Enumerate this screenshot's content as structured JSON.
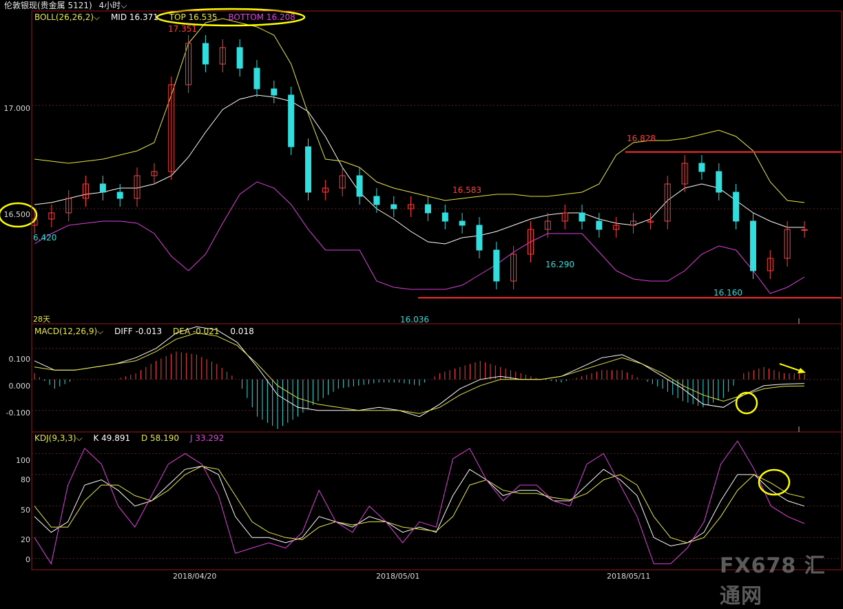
{
  "window": {
    "symbol": "伦敦银现(贵金属 5121)",
    "period": "4小时"
  },
  "colors": {
    "background": "#000000",
    "grid": "#6b1d1d",
    "up": "#ff4040",
    "down": "#33dddd",
    "mid": "#ffffff",
    "top": "#e8e846",
    "bottom": "#e040e0",
    "highlight": "#ffff00",
    "hline": "#ff3030"
  },
  "boll_panel": {
    "indicator": "BOLL(26,26,2)",
    "mid": "MID 16.371",
    "top": "TOP 16.535",
    "bottom": "BOTTOM 16.208",
    "yticks": [
      "17.000",
      "16.500"
    ],
    "days_label": "28天",
    "annotations": [
      {
        "text": "17.351",
        "color": "up"
      },
      {
        "text": "6.420",
        "color": "down"
      },
      {
        "text": "16.583",
        "color": "up"
      },
      {
        "text": "16.828",
        "color": "up"
      },
      {
        "text": "16.290",
        "color": "down"
      },
      {
        "text": "16.036",
        "color": "down"
      },
      {
        "text": "16.160",
        "color": "down"
      }
    ]
  },
  "macd_panel": {
    "indicator": "MACD(12,26,9)",
    "diff": "DIFF -0.013",
    "dea": "DEA -0.021",
    "macd": "0.018",
    "yticks": [
      "0.100",
      "0.000",
      "-0.100"
    ]
  },
  "kdj_panel": {
    "indicator": "KDJ(9,3,3)",
    "k": "K 49.891",
    "d": "D 58.190",
    "j": "J 33.292",
    "yticks": [
      "100",
      "80",
      "50",
      "20",
      "0"
    ]
  },
  "x_axis": {
    "dates": [
      "2018/04/20",
      "2018/05/01",
      "2018/05/11"
    ]
  },
  "watermark": "FX678 汇通网",
  "chart_data": [
    {
      "type": "line",
      "panel": "price",
      "indicator": "BOLL(26,26,2)",
      "ylim": [
        15.95,
        17.45
      ],
      "yticks": [
        17.0,
        16.5
      ],
      "x_dates": [
        "2018/04/20",
        "2018/05/01",
        "2018/05/11"
      ],
      "series": [
        {
          "name": "MID",
          "values": [
            16.52,
            16.53,
            16.55,
            16.57,
            16.58,
            16.6,
            16.6,
            16.62,
            16.66,
            16.75,
            16.87,
            16.98,
            17.03,
            17.05,
            17.04,
            17.02,
            16.97,
            16.85,
            16.7,
            16.58,
            16.5,
            16.45,
            16.39,
            16.34,
            16.33,
            16.36,
            16.37,
            16.39,
            16.42,
            16.45,
            16.47,
            16.48,
            16.48,
            16.45,
            16.43,
            16.42,
            16.45,
            16.54,
            16.6,
            16.62,
            16.6,
            16.54,
            16.48,
            16.44,
            16.41,
            16.41
          ]
        },
        {
          "name": "TOP",
          "values": [
            16.74,
            16.73,
            16.72,
            16.73,
            16.74,
            16.76,
            16.78,
            16.82,
            17.05,
            17.3,
            17.4,
            17.42,
            17.4,
            17.38,
            17.34,
            17.2,
            16.96,
            16.74,
            16.73,
            16.7,
            16.63,
            16.6,
            16.58,
            16.56,
            16.54,
            16.55,
            16.56,
            16.57,
            16.57,
            16.56,
            16.56,
            16.57,
            16.58,
            16.62,
            16.76,
            16.82,
            16.83,
            16.83,
            16.84,
            16.86,
            16.88,
            16.85,
            16.78,
            16.63,
            16.54,
            16.53
          ]
        },
        {
          "name": "BOTTOM",
          "values": [
            16.33,
            16.38,
            16.42,
            16.43,
            16.44,
            16.44,
            16.43,
            16.38,
            16.27,
            16.2,
            16.28,
            16.43,
            16.57,
            16.63,
            16.6,
            16.52,
            16.4,
            16.3,
            16.3,
            16.3,
            16.15,
            16.12,
            16.11,
            16.11,
            16.11,
            16.13,
            16.18,
            16.23,
            16.29,
            16.34,
            16.38,
            16.38,
            16.38,
            16.29,
            16.2,
            16.16,
            16.15,
            16.15,
            16.2,
            16.28,
            16.32,
            16.3,
            16.2,
            16.09,
            16.12,
            16.17
          ]
        }
      ],
      "candles_close": [
        16.45,
        16.48,
        16.55,
        16.62,
        16.58,
        16.55,
        16.66,
        16.68,
        17.1,
        17.3,
        17.2,
        17.28,
        17.18,
        17.08,
        17.05,
        16.8,
        16.58,
        16.6,
        16.66,
        16.56,
        16.52,
        16.5,
        16.52,
        16.48,
        16.44,
        16.42,
        16.3,
        16.15,
        16.28,
        16.4,
        16.44,
        16.48,
        16.44,
        16.4,
        16.42,
        16.44,
        16.44,
        16.62,
        16.72,
        16.68,
        16.58,
        16.44,
        16.2,
        16.26,
        16.4,
        16.4
      ],
      "price_labels": [
        17.351,
        16.42,
        16.583,
        16.828,
        16.29,
        16.036,
        16.16
      ]
    },
    {
      "type": "line",
      "panel": "MACD(12,26,9)",
      "ylim": [
        -0.165,
        0.175
      ],
      "yticks": [
        0.1,
        0.0,
        -0.1
      ],
      "series": [
        {
          "name": "DIFF",
          "values": [
            0.06,
            0.03,
            0.03,
            0.04,
            0.05,
            0.07,
            0.1,
            0.15,
            0.17,
            0.16,
            0.12,
            0.04,
            -0.05,
            -0.09,
            -0.1,
            -0.1,
            -0.1,
            -0.09,
            -0.1,
            -0.12,
            -0.08,
            -0.03,
            0.0,
            0.01,
            0.0,
            0.0,
            0.01,
            0.04,
            0.07,
            0.08,
            0.05,
            0.01,
            -0.03,
            -0.08,
            -0.09,
            -0.05,
            -0.02,
            -0.015,
            -0.013
          ]
        },
        {
          "name": "DEA",
          "values": [
            0.04,
            0.03,
            0.03,
            0.04,
            0.05,
            0.06,
            0.09,
            0.13,
            0.15,
            0.14,
            0.11,
            0.05,
            -0.02,
            -0.06,
            -0.08,
            -0.09,
            -0.1,
            -0.1,
            -0.1,
            -0.11,
            -0.09,
            -0.05,
            -0.02,
            0.0,
            0.0,
            0.0,
            0.01,
            0.03,
            0.05,
            0.07,
            0.05,
            0.02,
            -0.02,
            -0.05,
            -0.07,
            -0.05,
            -0.03,
            -0.022,
            -0.021
          ]
        }
      ],
      "histogram": [
        0.02,
        -0.03,
        0.0,
        0.0,
        0.0,
        0.02,
        0.06,
        0.09,
        0.08,
        0.05,
        0.0,
        -0.12,
        -0.16,
        -0.12,
        -0.07,
        -0.03,
        -0.02,
        -0.01,
        -0.01,
        -0.02,
        0.02,
        0.04,
        0.06,
        0.04,
        0.02,
        0.0,
        -0.01,
        0.01,
        0.03,
        0.03,
        0.0,
        -0.03,
        -0.07,
        -0.09,
        -0.06,
        0.02,
        0.04,
        0.02,
        0.018
      ]
    },
    {
      "type": "line",
      "panel": "KDJ(9,3,3)",
      "ylim": [
        -10,
        118
      ],
      "yticks": [
        100,
        80,
        50,
        20,
        0
      ],
      "series": [
        {
          "name": "K",
          "values": [
            40,
            25,
            35,
            70,
            75,
            65,
            50,
            55,
            70,
            85,
            88,
            80,
            40,
            20,
            20,
            15,
            20,
            40,
            35,
            30,
            40,
            35,
            25,
            30,
            25,
            60,
            85,
            75,
            60,
            65,
            65,
            55,
            55,
            70,
            85,
            75,
            60,
            20,
            12,
            15,
            25,
            55,
            80,
            80,
            65,
            55,
            49.9
          ]
        },
        {
          "name": "D",
          "values": [
            50,
            30,
            30,
            55,
            70,
            70,
            60,
            55,
            65,
            80,
            88,
            85,
            60,
            35,
            25,
            20,
            18,
            30,
            35,
            32,
            35,
            35,
            30,
            28,
            26,
            40,
            70,
            75,
            65,
            62,
            62,
            58,
            56,
            62,
            75,
            80,
            70,
            40,
            20,
            15,
            20,
            40,
            65,
            80,
            72,
            62,
            58.2
          ]
        },
        {
          "name": "J",
          "values": [
            20,
            -5,
            70,
            105,
            90,
            50,
            30,
            60,
            90,
            100,
            90,
            60,
            5,
            10,
            15,
            10,
            25,
            65,
            35,
            25,
            50,
            35,
            15,
            35,
            30,
            95,
            105,
            75,
            55,
            70,
            70,
            55,
            50,
            90,
            100,
            70,
            40,
            -5,
            -5,
            10,
            35,
            90,
            112,
            85,
            50,
            40,
            33.3
          ]
        }
      ]
    }
  ]
}
